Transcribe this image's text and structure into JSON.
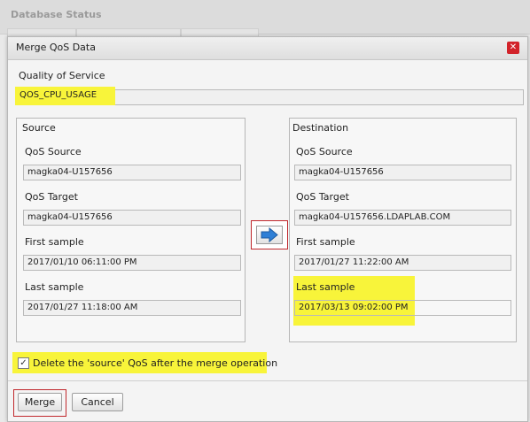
{
  "background": {
    "title": "Database Status"
  },
  "dialog": {
    "title": "Merge QoS Data",
    "close_glyph": "✕",
    "qos_label": "Quality of Service",
    "qos_value": "QOS_CPU_USAGE",
    "source": {
      "heading": "Source",
      "qos_source_label": "QoS Source",
      "qos_source_value": "magka04-U157656",
      "qos_target_label": "QoS Target",
      "qos_target_value": "magka04-U157656",
      "first_sample_label": "First sample",
      "first_sample_value": "2017/01/10 06:11:00 PM",
      "last_sample_label": "Last sample",
      "last_sample_value": "2017/01/27 11:18:00 AM"
    },
    "destination": {
      "heading": "Destination",
      "qos_source_label": "QoS Source",
      "qos_source_value": "magka04-U157656",
      "qos_target_label": "QoS Target",
      "qos_target_value": "magka04-U157656.LDAPLAB.COM",
      "first_sample_label": "First sample",
      "first_sample_value": "2017/01/27 11:22:00 AM",
      "last_sample_label": "Last sample",
      "last_sample_value": "2017/03/13 09:02:00 PM"
    },
    "delete_checkbox": {
      "label": "Delete the 'source' QoS after the merge operation",
      "checked": true,
      "check_glyph": "✓"
    },
    "buttons": {
      "merge": "Merge",
      "cancel": "Cancel"
    }
  },
  "colors": {
    "highlight": "#f8f43a",
    "close_red": "#d2232a",
    "outline_red": "#c0282d",
    "arrow_blue": "#2f7fd6"
  }
}
